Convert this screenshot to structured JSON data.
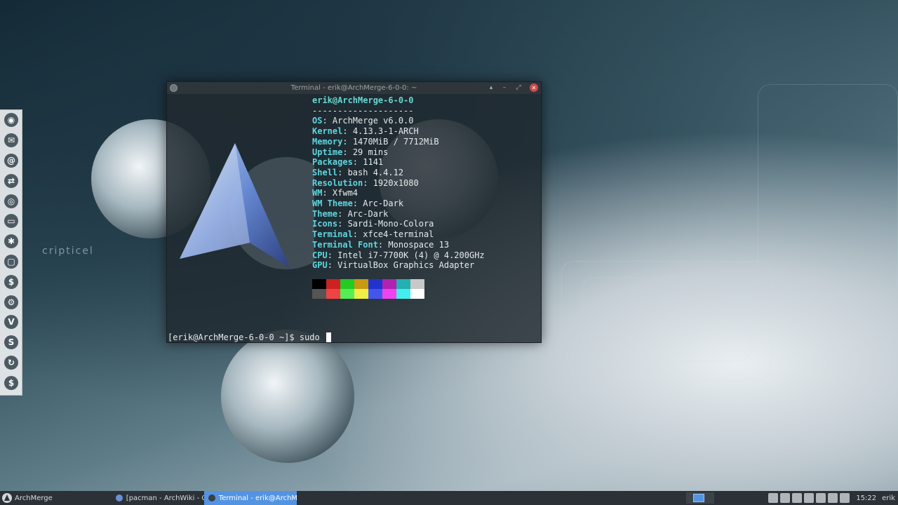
{
  "desktop": {
    "watermark": "cripticel",
    "dock_items": [
      {
        "name": "firefox",
        "glyph": "◉"
      },
      {
        "name": "thunderbird",
        "glyph": "✉"
      },
      {
        "name": "debian",
        "glyph": "@"
      },
      {
        "name": "teamviewer",
        "glyph": "⇄"
      },
      {
        "name": "chrome",
        "glyph": "◎"
      },
      {
        "name": "files",
        "glyph": "▭"
      },
      {
        "name": "aperture",
        "glyph": "✱"
      },
      {
        "name": "window",
        "glyph": "▢"
      },
      {
        "name": "dollar",
        "glyph": "$"
      },
      {
        "name": "settings",
        "glyph": "⚙"
      },
      {
        "name": "vivaldi",
        "glyph": "V"
      },
      {
        "name": "skype",
        "glyph": "S"
      },
      {
        "name": "refresh",
        "glyph": "↻"
      },
      {
        "name": "terminal",
        "glyph": "$"
      }
    ]
  },
  "terminal": {
    "title": "Terminal - erik@ArchMerge-6-0-0: ~",
    "header": "erik@ArchMerge-6-0-0",
    "separator": "--------------------",
    "info": [
      {
        "key": "OS",
        "value": "ArchMerge v6.0.0"
      },
      {
        "key": "Kernel",
        "value": "4.13.3-1-ARCH"
      },
      {
        "key": "Memory",
        "value": "1470MiB / 7712MiB"
      },
      {
        "key": "Uptime",
        "value": "29 mins"
      },
      {
        "key": "Packages",
        "value": "1141"
      },
      {
        "key": "Shell",
        "value": "bash 4.4.12"
      },
      {
        "key": "Resolution",
        "value": "1920x1080"
      },
      {
        "key": "WM",
        "value": "Xfwm4"
      },
      {
        "key": "WM Theme",
        "value": "Arc-Dark"
      },
      {
        "key": "Theme",
        "value": "Arc-Dark"
      },
      {
        "key": "Icons",
        "value": "Sardi-Mono-Colora"
      },
      {
        "key": "Terminal",
        "value": "xfce4-terminal"
      },
      {
        "key": "Terminal Font",
        "value": "Monospace 13"
      },
      {
        "key": "CPU",
        "value": "Intel i7-7700K (4) @ 4.200GHz"
      },
      {
        "key": "GPU",
        "value": "VirtualBox Graphics Adapter"
      }
    ],
    "colors_top": [
      "#000000",
      "#cc2222",
      "#22cc22",
      "#c79a12",
      "#2232cc",
      "#b022b0",
      "#22b0b0",
      "#c8c8c8"
    ],
    "colors_bottom": [
      "#555555",
      "#ee4444",
      "#55ee55",
      "#eeee44",
      "#4455ee",
      "#ee44ee",
      "#44eeee",
      "#ffffff"
    ],
    "prompt": "[erik@ArchMerge-6-0-0 ~]$ sudo "
  },
  "taskbar": {
    "start_label": "ArchMerge",
    "tasks": [
      {
        "label": "[pacman - ArchWiki - Chro...",
        "active": false,
        "icon_color": "#6a8fd8"
      },
      {
        "label": "Terminal - erik@ArchMer...",
        "active": true,
        "icon_color": "#3b3f42"
      }
    ],
    "clock": "15:22",
    "user": "erik"
  }
}
